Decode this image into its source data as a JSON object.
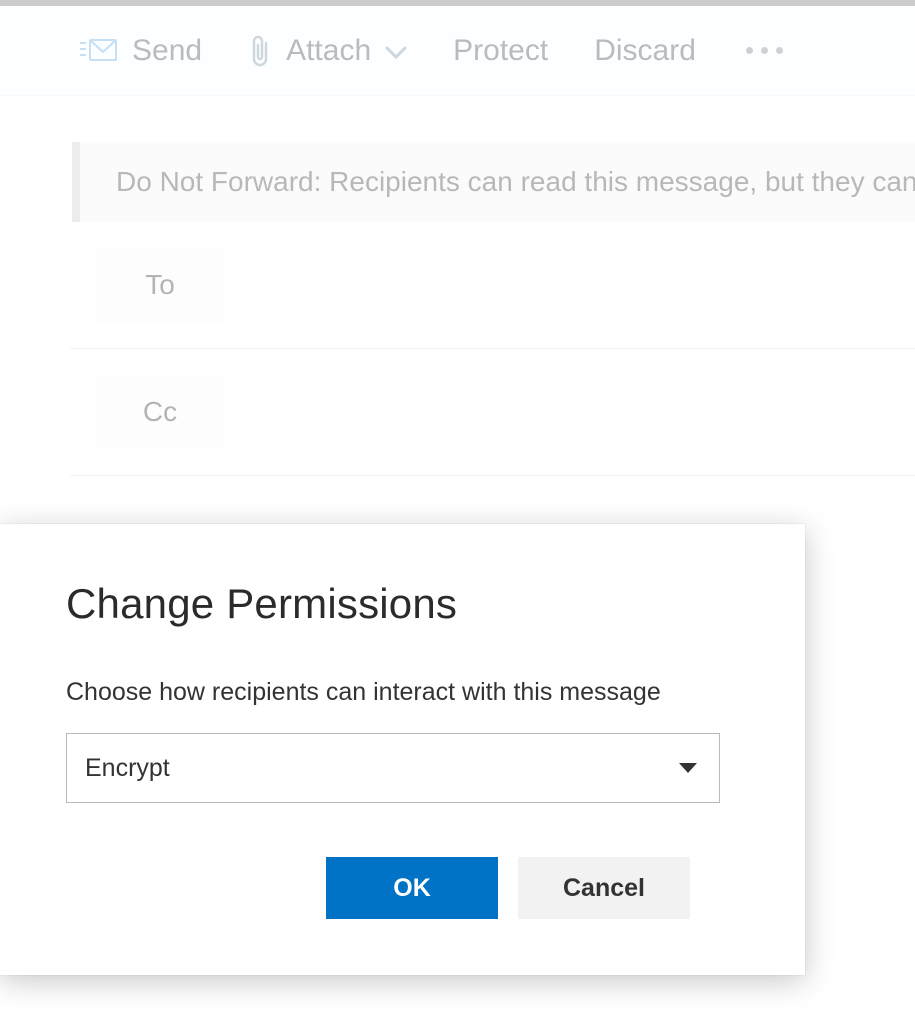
{
  "toolbar": {
    "send_label": "Send",
    "attach_label": "Attach",
    "protect_label": "Protect",
    "discard_label": "Discard"
  },
  "banner": {
    "text": "Do Not Forward: Recipients can read this message, but they can"
  },
  "fields": {
    "to_label": "To",
    "cc_label": "Cc"
  },
  "dialog": {
    "title": "Change Permissions",
    "description": "Choose how recipients can interact with this message",
    "selected_option": "Encrypt",
    "ok_label": "OK",
    "cancel_label": "Cancel"
  }
}
